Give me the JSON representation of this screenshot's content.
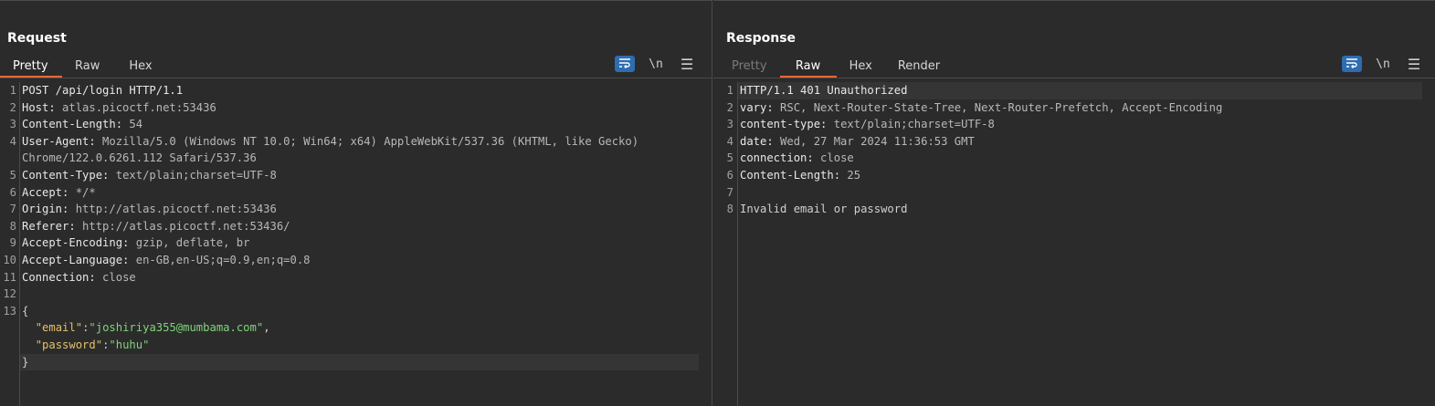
{
  "layout_switch": {
    "buttons": [
      {
        "name": "side-by-side-layout-icon",
        "active": true
      },
      {
        "name": "stacked-layout-icon",
        "active": false
      },
      {
        "name": "single-pane-layout-icon",
        "active": false
      }
    ]
  },
  "request": {
    "title": "Request",
    "tabs": [
      {
        "label": "Pretty",
        "active": true
      },
      {
        "label": "Raw",
        "active": false
      },
      {
        "label": "Hex",
        "active": false
      }
    ],
    "tools": {
      "newline_label": "\\n",
      "menu_label": "☰"
    },
    "lines": [
      {
        "n": "1",
        "key": "POST /api/login HTTP/1.1",
        "val": ""
      },
      {
        "n": "2",
        "key": "Host:",
        "val": " atlas.picoctf.net:53436"
      },
      {
        "n": "3",
        "key": "Content-Length:",
        "val": " 54"
      },
      {
        "n": "4",
        "key": "User-Agent:",
        "val": " Mozilla/5.0 (Windows NT 10.0; Win64; x64) AppleWebKit/537.36 (KHTML, like Gecko) Chrome/122.0.6261.112 Safari/537.36"
      },
      {
        "n": "5",
        "key": "Content-Type:",
        "val": " text/plain;charset=UTF-8"
      },
      {
        "n": "6",
        "key": "Accept:",
        "val": " */*"
      },
      {
        "n": "7",
        "key": "Origin:",
        "val": " http://atlas.picoctf.net:53436"
      },
      {
        "n": "8",
        "key": "Referer:",
        "val": " http://atlas.picoctf.net:53436/"
      },
      {
        "n": "9",
        "key": "Accept-Encoding:",
        "val": " gzip, deflate, br"
      },
      {
        "n": "10",
        "key": "Accept-Language:",
        "val": " en-GB,en-US;q=0.9,en;q=0.8"
      },
      {
        "n": "11",
        "key": "Connection:",
        "val": " close"
      },
      {
        "n": "12",
        "key": "",
        "val": ""
      }
    ],
    "json_body": {
      "line_number": "13",
      "open_brace": "{",
      "close_brace": "}",
      "email_key": "\"email\"",
      "email_value": "\"joshiriya355@mumbama.com\"",
      "password_key": "\"password\"",
      "password_value": "\"huhu\"",
      "colon": ":",
      "comma": ","
    }
  },
  "response": {
    "title": "Response",
    "tabs": [
      {
        "label": "Pretty",
        "active": false,
        "disabled": true
      },
      {
        "label": "Raw",
        "active": true
      },
      {
        "label": "Hex",
        "active": false
      },
      {
        "label": "Render",
        "active": false
      }
    ],
    "tools": {
      "newline_label": "\\n",
      "menu_label": "☰"
    },
    "lines": [
      {
        "n": "1",
        "key": "HTTP/1.1 401 Unauthorized",
        "val": ""
      },
      {
        "n": "2",
        "key": "vary:",
        "val": " RSC, Next-Router-State-Tree, Next-Router-Prefetch, Accept-Encoding"
      },
      {
        "n": "3",
        "key": "content-type:",
        "val": " text/plain;charset=UTF-8"
      },
      {
        "n": "4",
        "key": "date:",
        "val": " Wed, 27 Mar 2024 11:36:53 GMT"
      },
      {
        "n": "5",
        "key": "connection:",
        "val": " close"
      },
      {
        "n": "6",
        "key": "Content-Length:",
        "val": " 25"
      },
      {
        "n": "7",
        "key": "",
        "val": ""
      },
      {
        "n": "8",
        "key": "Invalid email or password",
        "val": ""
      }
    ]
  },
  "colors": {
    "accent_tab_underline": "#e8683a",
    "active_tool_bg": "#2d6db0",
    "json_key": "#e4c06a",
    "json_string": "#7fd47a"
  }
}
